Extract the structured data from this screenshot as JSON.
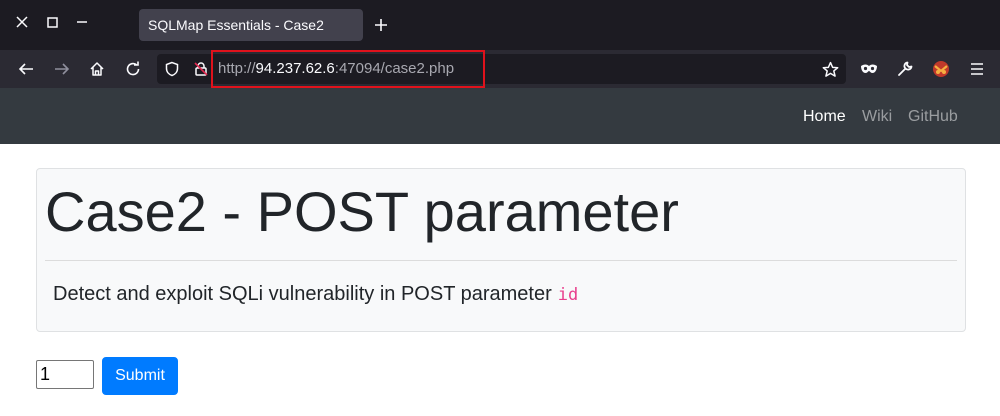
{
  "browser": {
    "tab_title": "SQLMap Essentials - Case2",
    "url": {
      "scheme": "http://",
      "host": "94.237.62.6",
      "rest": ":47094/case2.php"
    },
    "colors": {
      "highlight": "#e0121c"
    }
  },
  "site": {
    "nav": {
      "home": "Home",
      "wiki": "Wiki",
      "github": "GitHub"
    }
  },
  "main": {
    "title": "Case2 - POST parameter",
    "description": "Detect and exploit SQLi vulnerability in POST parameter",
    "param_name": "id",
    "form": {
      "input_value": "1",
      "submit_label": "Submit"
    }
  }
}
